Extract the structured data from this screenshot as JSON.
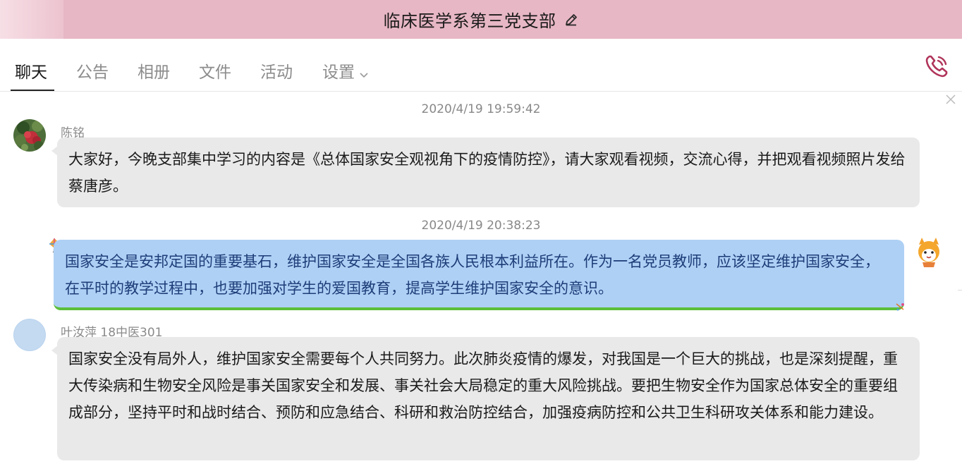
{
  "window": {
    "title": "临床医学系第三党支部"
  },
  "tabs": [
    {
      "label": "聊天"
    },
    {
      "label": "公告"
    },
    {
      "label": "相册"
    },
    {
      "label": "文件"
    },
    {
      "label": "活动"
    },
    {
      "label": "设置"
    }
  ],
  "icons": {
    "edit": "edit-pencil-icon",
    "phone": "phone-call-icon",
    "close": "close-icon",
    "chevron": "chevron-down-icon"
  },
  "colors": {
    "titlebar": "#e7b7c5",
    "bubble_gray": "#e9e9e9",
    "bubble_blue": "#aed0f5",
    "phone_accent": "#b0345a"
  },
  "messages": [
    {
      "timestamp": "2020/4/19 19:59:42",
      "sender": "陈铭",
      "text": "大家好，今晚支部集中学习的内容是《总体国家安全观视角下的疫情防控》，请大家观看视频，交流心得，并把观看视频照片发给蔡唐彦。",
      "self": false
    },
    {
      "timestamp": "2020/4/19 20:38:23",
      "sender": "",
      "text": "国家安全是安邦定国的重要基石，维护国家安全是全国各族人民根本利益所在。作为一名党员教师，应该坚定维护国家安全，在平时的教学过程中，也要加强对学生的爱国教育，提高学生维护国家安全的意识。",
      "self": true
    },
    {
      "timestamp": "",
      "sender": "叶汝萍 18中医301",
      "text": "国家安全没有局外人，维护国家安全需要每个人共同努力。此次肺炎疫情的爆发，对我国是一个巨大的挑战，也是深刻提醒，重大传染病和生物安全风险是事关国家安全和发展、事关社会大局稳定的重大风险挑战。要把生物安全作为国家总体安全的重要组成部分，坚持平时和战时结合、预防和应急结合、科研和救治防控结合，加强疫病防控和公共卫生科研攻关体系和能力建设。",
      "self": false
    }
  ]
}
